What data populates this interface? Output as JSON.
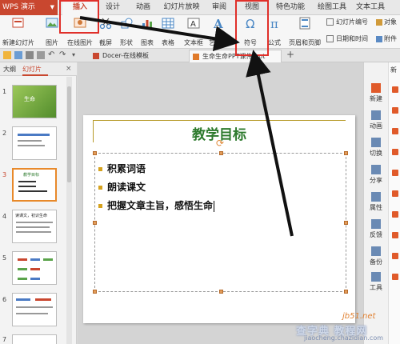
{
  "menubar": {
    "app_name": "WPS 演示",
    "tabs": [
      "插入",
      "设计",
      "动画",
      "幻灯片放映",
      "审阅",
      "视图",
      "特色功能",
      "绘图工具",
      "文本工具"
    ]
  },
  "ribbon": {
    "new_slide": "新建幻灯片",
    "picture": "图片",
    "online_picture": "在线图片",
    "screenshot": "截屏",
    "shape": "形状",
    "chart": "图表",
    "table": "表格",
    "textbox": "文本框",
    "wordart": "艺术字",
    "symbol": "符号",
    "formula": "公式",
    "header_footer": "页眉和页脚",
    "datetime": "日期和时间",
    "slide_number": "幻灯片编号",
    "object": "对象",
    "attachment": "附件"
  },
  "docbar": {
    "tabs": [
      "Docer-在线模板",
      "生命生命PPT课件.ppt"
    ],
    "add": "+"
  },
  "leftpane": {
    "tabs": [
      "大纲",
      "幻灯片"
    ],
    "slide_numbers": [
      "1",
      "2",
      "3",
      "4",
      "5",
      "6",
      "7"
    ],
    "thumb1_text": "生命",
    "thumb3_title": "教学目标",
    "thumb4_title": "读课文，初识生命"
  },
  "slide": {
    "title": "教学目标",
    "bullets": [
      "积累词语",
      "朗读课文",
      "把握文章主旨，感悟生命"
    ]
  },
  "rightbar": {
    "items": [
      "新建",
      "动画",
      "切换",
      "分享",
      "属性",
      "反馈",
      "备份",
      "工具"
    ],
    "strip_top": "新"
  },
  "watermark": {
    "site": "jb51.net",
    "name": "查字典 教程网",
    "url": "jiaocheng.chazidian.com"
  },
  "colors": {
    "brand": "#c9472f",
    "annotation": "#e0302a",
    "title_green": "#2d7a2d",
    "bullet_gold": "#d6a21e"
  }
}
